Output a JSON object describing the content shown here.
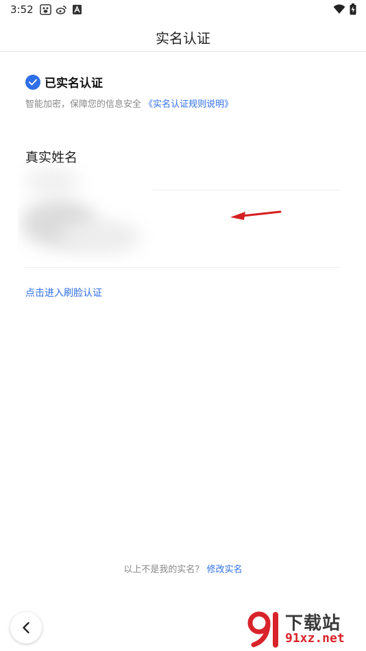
{
  "status_bar": {
    "time": "3:52",
    "left_icons": [
      "baidu-paw-icon",
      "weibo-icon",
      "font-a-icon"
    ],
    "right_icons": [
      "wifi-icon",
      "battery-charging-icon"
    ]
  },
  "header": {
    "title": "实名认证"
  },
  "verified": {
    "label": "已实名认证",
    "subtitle": "智能加密，保障您的信息安全",
    "rules_link": "《实名认证规则说明》"
  },
  "realname": {
    "label": "真实姓名"
  },
  "face_auth_link": "点击进入刷脸认证",
  "bottom": {
    "prompt": "以上不是我的实名？",
    "modify_link": "修改实名"
  },
  "watermark": {
    "logo_text": "91",
    "name": "下载站",
    "domain": "91xz.net"
  },
  "colors": {
    "accent": "#2f6fe8",
    "arrow": "#d42020",
    "watermark_red": "#d8232a"
  }
}
